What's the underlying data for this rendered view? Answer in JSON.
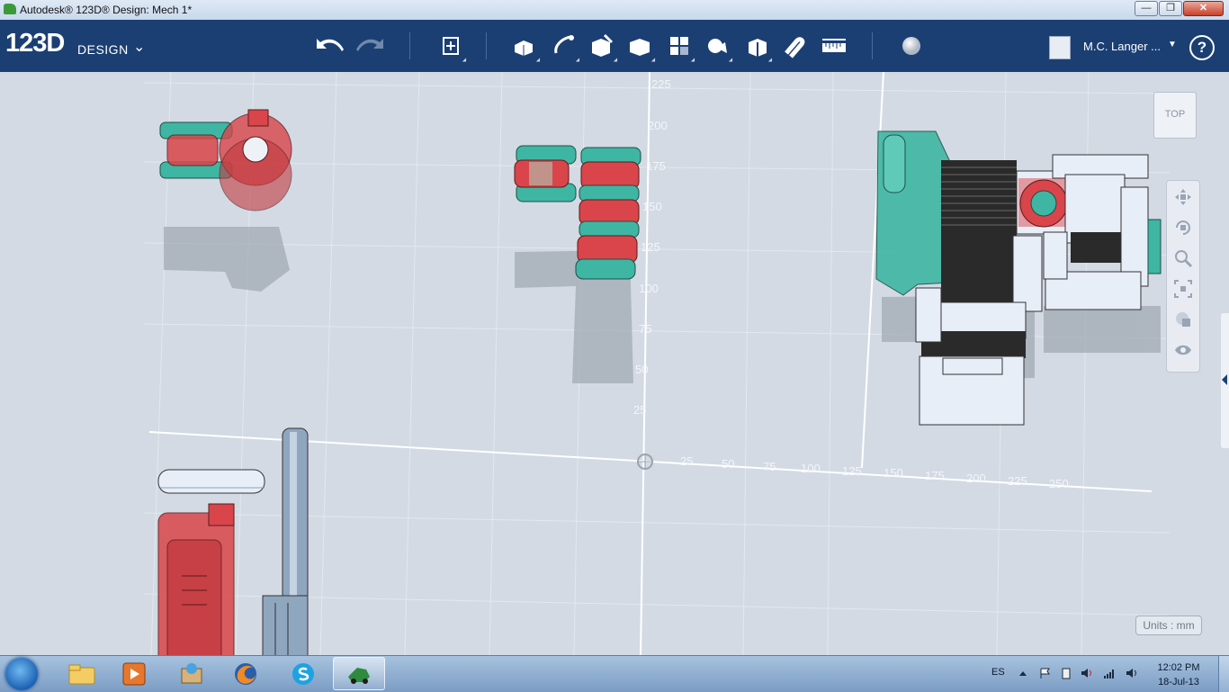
{
  "window": {
    "title": "Autodesk® 123D® Design: Mech 1*",
    "controls": {
      "minimize": "—",
      "maximize": "❐",
      "close": "✕"
    }
  },
  "brand": {
    "logo_big": "123D",
    "logo_small": "DESIGN",
    "caret": "⌄"
  },
  "toolbar": {
    "undo_icon": "undo-arrow-icon",
    "redo_icon": "redo-arrow-icon",
    "tools": [
      "transform",
      "primitives",
      "sketch",
      "construct",
      "modify",
      "pattern",
      "grouping",
      "combine",
      "measure",
      "snap",
      "ruler",
      "material"
    ]
  },
  "user": {
    "name": "M.C. Langer ...",
    "help": "?"
  },
  "viewport": {
    "viewcube_label": "TOP",
    "units_label": "Units : mm",
    "y_ticks": [
      "225",
      "200",
      "175",
      "150",
      "125",
      "100",
      "75",
      "50",
      "25"
    ],
    "x_ticks": [
      "25",
      "50",
      "75",
      "100",
      "125",
      "150",
      "175",
      "200",
      "225",
      "250"
    ],
    "colors": {
      "teal": "#3fb6a3",
      "red": "#d9454a",
      "light_part": "#e8eef8",
      "dark_part": "#2a2a2a",
      "rod": "#8fa6bf"
    }
  },
  "nav": [
    "pan-icon",
    "orbit-icon",
    "zoom-icon",
    "fit-icon",
    "material-view-icon",
    "visibility-eye-icon"
  ],
  "taskbar": {
    "apps": [
      "file-explorer-icon",
      "media-player-icon",
      "paint-icon",
      "firefox-icon",
      "skype-icon",
      "123d-design-icon"
    ],
    "language": "ES",
    "time": "12:02 PM",
    "date": "18-Jul-13"
  }
}
